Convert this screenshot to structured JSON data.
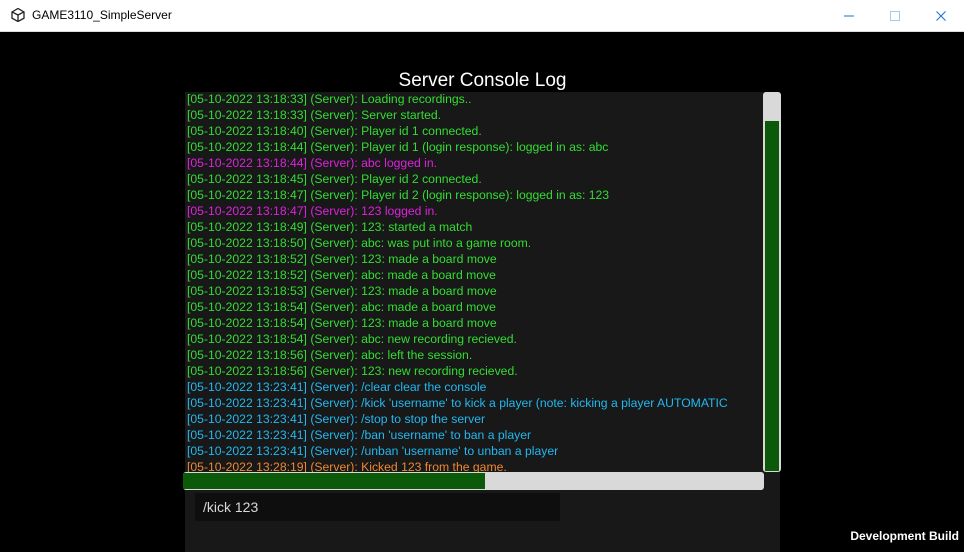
{
  "window": {
    "title": "GAME3110_SimpleServer"
  },
  "console": {
    "title": "Server Console Log",
    "colors": {
      "green": "#33dd33",
      "magenta": "#dd22dd",
      "cyan": "#22b8f0",
      "orange": "#ee8833"
    },
    "log": [
      {
        "text": "[05-10-2022 13:18:33] (Server): Loading recordings..",
        "color": "green"
      },
      {
        "text": "[05-10-2022 13:18:33] (Server): Server started.",
        "color": "green"
      },
      {
        "text": "[05-10-2022 13:18:40] (Server): Player id 1 connected.",
        "color": "green"
      },
      {
        "text": "[05-10-2022 13:18:44] (Server): Player id 1 (login response): logged in as: abc",
        "color": "green"
      },
      {
        "text": "[05-10-2022 13:18:44] (Server): abc logged in.",
        "color": "magenta"
      },
      {
        "text": "[05-10-2022 13:18:45] (Server): Player id 2 connected.",
        "color": "green"
      },
      {
        "text": "[05-10-2022 13:18:47] (Server): Player id 2 (login response): logged in as: 123",
        "color": "green"
      },
      {
        "text": "[05-10-2022 13:18:47] (Server): 123 logged in.",
        "color": "magenta"
      },
      {
        "text": "[05-10-2022 13:18:49] (Server): 123: started a match",
        "color": "green"
      },
      {
        "text": "[05-10-2022 13:18:50] (Server): abc: was put into a game room.",
        "color": "green"
      },
      {
        "text": "[05-10-2022 13:18:52] (Server): 123: made a board move",
        "color": "green"
      },
      {
        "text": "[05-10-2022 13:18:52] (Server): abc: made a board move",
        "color": "green"
      },
      {
        "text": "[05-10-2022 13:18:53] (Server): 123: made a board move",
        "color": "green"
      },
      {
        "text": "[05-10-2022 13:18:54] (Server): abc: made a board move",
        "color": "green"
      },
      {
        "text": "[05-10-2022 13:18:54] (Server): 123: made a board move",
        "color": "green"
      },
      {
        "text": "[05-10-2022 13:18:54] (Server): abc: new recording recieved.",
        "color": "green"
      },
      {
        "text": "[05-10-2022 13:18:56] (Server): abc: left the session.",
        "color": "green"
      },
      {
        "text": "[05-10-2022 13:18:56] (Server): 123: new recording recieved.",
        "color": "green"
      },
      {
        "text": "[05-10-2022 13:23:41] (Server): /clear clear the console",
        "color": "cyan"
      },
      {
        "text": "[05-10-2022 13:23:41] (Server): /kick 'username' to kick a player (note: kicking a player AUTOMATIC",
        "color": "cyan"
      },
      {
        "text": "[05-10-2022 13:23:41] (Server): /stop to stop the server",
        "color": "cyan"
      },
      {
        "text": "[05-10-2022 13:23:41] (Server): /ban 'username' to ban a player",
        "color": "cyan"
      },
      {
        "text": "[05-10-2022 13:23:41] (Server): /unban 'username' to unban a player",
        "color": "cyan"
      },
      {
        "text": "[05-10-2022 13:28:19] (Server): Kicked 123 from the game.",
        "color": "orange"
      }
    ],
    "vertical_scroll_fraction": 0.93,
    "horizontal_scroll_fraction": 0.52
  },
  "input": {
    "value": "/kick 123"
  },
  "footer": {
    "build_label": "Development Build"
  }
}
